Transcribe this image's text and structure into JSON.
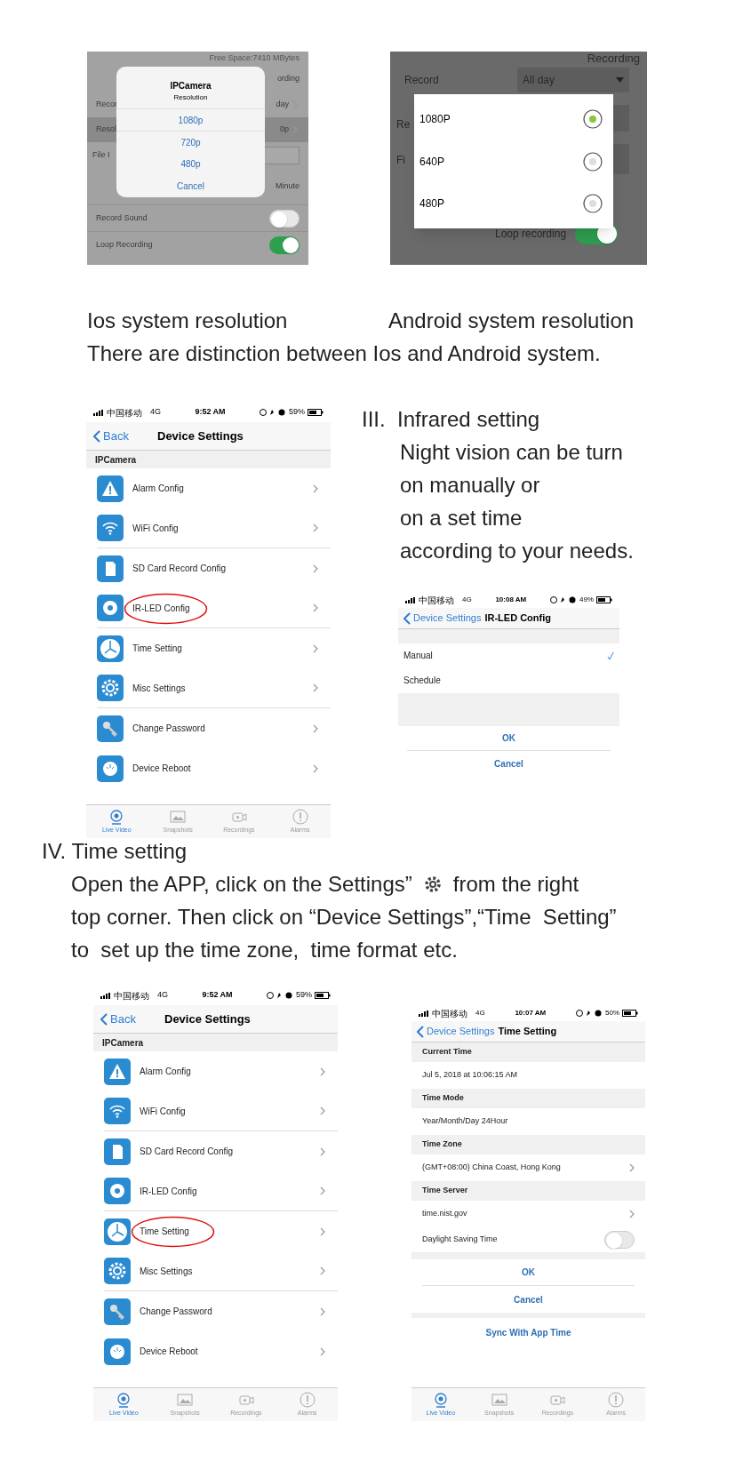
{
  "ios_screenshot": {
    "free_space": "Free Space:7410 MBytes",
    "header_fragment": "ording",
    "rows": [
      {
        "label": "Recor",
        "value": "day",
        "highlighted": false
      },
      {
        "label": "Resol",
        "value": "0p",
        "highlighted": true
      }
    ],
    "file_label": "File I",
    "minute_value": "Minute",
    "toggles": [
      {
        "label": "Record Sound",
        "on": false
      },
      {
        "label": "Loop Recording",
        "on": true
      }
    ],
    "dialog": {
      "title": "IPCamera",
      "subtitle": "Resolution",
      "options": [
        "1080p",
        "720p",
        "480p"
      ],
      "cancel": "Cancel"
    }
  },
  "android_screenshot": {
    "header": "Recording",
    "record_label": "Record",
    "record_value": "All day",
    "fragments": [
      "Re",
      "Fi"
    ],
    "options": [
      {
        "label": "1080P",
        "selected": true
      },
      {
        "label": "640P",
        "selected": false
      },
      {
        "label": "480P",
        "selected": false
      }
    ],
    "loop": {
      "label": "Loop recording",
      "on": true
    }
  },
  "captions": {
    "ios": "Ios system resolution",
    "android": "Android system resolution",
    "note": "There are distinction between Ios and Android system."
  },
  "device_settings_screens": [
    {
      "status": {
        "carrier": "中国移动",
        "network": "4G",
        "time": "9:52 AM",
        "battery": "59%"
      },
      "back": "Back",
      "title": "Device Settings",
      "section": "IPCamera",
      "items": [
        {
          "kind": "warning",
          "label": "Alarm Config",
          "circled": false
        },
        {
          "kind": "wifi",
          "label": "WiFi Config",
          "circled": false
        },
        {
          "kind": "sd",
          "label": "SD Card Record Config",
          "circled": false
        },
        {
          "kind": "led",
          "label": "IR-LED Config",
          "circled": true
        },
        {
          "kind": "clock",
          "label": "Time Setting",
          "circled": false
        },
        {
          "kind": "gear",
          "label": "Misc Settings",
          "circled": false
        },
        {
          "kind": "key",
          "label": "Change Password",
          "circled": false
        },
        {
          "kind": "reboot",
          "label": "Device Reboot",
          "circled": false
        }
      ],
      "tabs": [
        {
          "kind": "live",
          "label": "Live Video",
          "selected": true
        },
        {
          "kind": "snap",
          "label": "Snapshots",
          "selected": false
        },
        {
          "kind": "rec",
          "label": "Recordings",
          "selected": false
        },
        {
          "kind": "alarm",
          "label": "Alarms",
          "selected": false
        }
      ]
    },
    {
      "status": {
        "carrier": "中国移动",
        "network": "4G",
        "time": "9:52 AM",
        "battery": "59%"
      },
      "back": "Back",
      "title": "Device Settings",
      "section": "IPCamera",
      "items": [
        {
          "kind": "warning",
          "label": "Alarm Config",
          "circled": false
        },
        {
          "kind": "wifi",
          "label": "WiFi Config",
          "circled": false
        },
        {
          "kind": "sd",
          "label": "SD Card Record Config",
          "circled": false
        },
        {
          "kind": "led",
          "label": "IR-LED Config",
          "circled": false
        },
        {
          "kind": "clock",
          "label": "Time Setting",
          "circled": true
        },
        {
          "kind": "gear",
          "label": "Misc Settings",
          "circled": false
        },
        {
          "kind": "key",
          "label": "Change Password",
          "circled": false
        },
        {
          "kind": "reboot",
          "label": "Device Reboot",
          "circled": false
        }
      ],
      "tabs": [
        {
          "kind": "live",
          "label": "Live Video",
          "selected": true
        },
        {
          "kind": "snap",
          "label": "Snapshots",
          "selected": false
        },
        {
          "kind": "rec",
          "label": "Recordings",
          "selected": false
        },
        {
          "kind": "alarm",
          "label": "Alarms",
          "selected": false
        }
      ]
    }
  ],
  "infrared_section": {
    "heading": "III.  Infrared setting",
    "lines": [
      "Night vision can be turn",
      "on manually or",
      "on a set time",
      "according to your needs."
    ]
  },
  "ir_led_screen": {
    "status": {
      "carrier": "中国移动",
      "network": "4G",
      "time": "10:08 AM",
      "battery": "49%"
    },
    "back": "Device Settings",
    "title": "IR-LED Config",
    "options": [
      {
        "label": "Manual",
        "selected": true
      },
      {
        "label": "Schedule",
        "selected": false
      }
    ],
    "ok": "OK",
    "cancel": "Cancel"
  },
  "time_section": {
    "heading": "IV. Time setting",
    "line_1_start": "Open the APP, click on the Settings”",
    "line_1_end": "from the right",
    "lines": [
      "top corner. Then click on “Device Settings”,“Time  Setting”",
      "to  set up the time zone,  time format etc."
    ]
  },
  "time_setting_screen": {
    "status": {
      "carrier": "中国移动",
      "network": "4G",
      "time": "10:07 AM",
      "battery": "50%"
    },
    "back": "Device Settings",
    "title": "Time Setting",
    "groups": [
      {
        "header": "Current Time",
        "value": "Jul 5, 2018 at 10:06:15 AM",
        "chevron": false
      },
      {
        "header": "Time Mode",
        "value": "Year/Month/Day 24Hour",
        "chevron": false
      },
      {
        "header": "Time Zone",
        "value": "(GMT+08:00) China Coast, Hong Kong",
        "chevron": true
      },
      {
        "header": "Time Server",
        "value": "time.nist.gov",
        "chevron": true
      }
    ],
    "daylight": {
      "label": "Daylight Saving Time",
      "on": false
    },
    "ok": "OK",
    "cancel": "Cancel",
    "sync": "Sync With App Time",
    "tabs": [
      {
        "kind": "live",
        "label": "Live Video",
        "selected": true
      },
      {
        "kind": "snap",
        "label": "Snapshots",
        "selected": false
      },
      {
        "kind": "rec",
        "label": "Recordings",
        "selected": false
      },
      {
        "kind": "alarm",
        "label": "Alarms",
        "selected": false
      }
    ]
  }
}
